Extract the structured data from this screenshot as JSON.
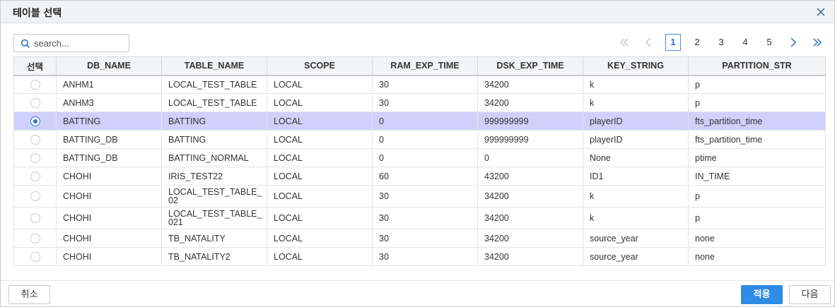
{
  "dialog": {
    "title": "테이블 선택",
    "close_icon": "close-icon"
  },
  "search": {
    "placeholder": "search...",
    "value": ""
  },
  "pagination": {
    "pages": [
      "1",
      "2",
      "3",
      "4",
      "5"
    ],
    "current": "1",
    "icons": [
      "double-chevron-left-icon",
      "chevron-left-icon",
      "chevron-right-icon",
      "double-chevron-right-icon"
    ]
  },
  "table": {
    "columns": [
      "선택",
      "DB_NAME",
      "TABLE_NAME",
      "SCOPE",
      "RAM_EXP_TIME",
      "DSK_EXP_TIME",
      "KEY_STRING",
      "PARTITION_STR"
    ],
    "rows": [
      {
        "selected": false,
        "db_name": "ANHM1",
        "table_name": "LOCAL_TEST_TABLE",
        "scope": "LOCAL",
        "ram_exp_time": "30",
        "dsk_exp_time": "34200",
        "key_string": "k",
        "partition_str": "p"
      },
      {
        "selected": false,
        "db_name": "ANHM3",
        "table_name": "LOCAL_TEST_TABLE",
        "scope": "LOCAL",
        "ram_exp_time": "30",
        "dsk_exp_time": "34200",
        "key_string": "k",
        "partition_str": "p"
      },
      {
        "selected": true,
        "db_name": "BATTING",
        "table_name": "BATTING",
        "scope": "LOCAL",
        "ram_exp_time": "0",
        "dsk_exp_time": "999999999",
        "key_string": "playerID",
        "partition_str": "fts_partition_time"
      },
      {
        "selected": false,
        "db_name": "BATTING_DB",
        "table_name": "BATTING",
        "scope": "LOCAL",
        "ram_exp_time": "0",
        "dsk_exp_time": "999999999",
        "key_string": "playerID",
        "partition_str": "fts_partition_time"
      },
      {
        "selected": false,
        "db_name": "BATTING_DB",
        "table_name": "BATTING_NORMAL",
        "scope": "LOCAL",
        "ram_exp_time": "0",
        "dsk_exp_time": "0",
        "key_string": "None",
        "partition_str": "ptime"
      },
      {
        "selected": false,
        "db_name": "CHOHI",
        "table_name": "IRIS_TEST22",
        "scope": "LOCAL",
        "ram_exp_time": "60",
        "dsk_exp_time": "43200",
        "key_string": "ID1",
        "partition_str": "IN_TIME"
      },
      {
        "selected": false,
        "db_name": "CHOHI",
        "table_name": "LOCAL_TEST_TABLE_02",
        "table_name_lines": [
          "LOCAL_TEST_TABLE_",
          "02"
        ],
        "scope": "LOCAL",
        "ram_exp_time": "30",
        "dsk_exp_time": "34200",
        "key_string": "k",
        "partition_str": "p"
      },
      {
        "selected": false,
        "db_name": "CHOHI",
        "table_name": "LOCAL_TEST_TABLE_021",
        "table_name_lines": [
          "LOCAL_TEST_TABLE_",
          "021"
        ],
        "scope": "LOCAL",
        "ram_exp_time": "30",
        "dsk_exp_time": "34200",
        "key_string": "k",
        "partition_str": "p"
      },
      {
        "selected": false,
        "db_name": "CHOHI",
        "table_name": "TB_NATALITY",
        "scope": "LOCAL",
        "ram_exp_time": "30",
        "dsk_exp_time": "34200",
        "key_string": "source_year",
        "partition_str": "none"
      },
      {
        "selected": false,
        "db_name": "CHOHI",
        "table_name": "TB_NATALITY2",
        "scope": "LOCAL",
        "ram_exp_time": "30",
        "dsk_exp_time": "34200",
        "key_string": "source_year",
        "partition_str": "none"
      }
    ]
  },
  "footer": {
    "cancel_label": "취소",
    "apply_label": "적용",
    "next_label": "다음"
  },
  "colors": {
    "accent": "#2f8be6",
    "selected_row": "#cfd0fb",
    "header_bg": "#f1f2f4"
  }
}
